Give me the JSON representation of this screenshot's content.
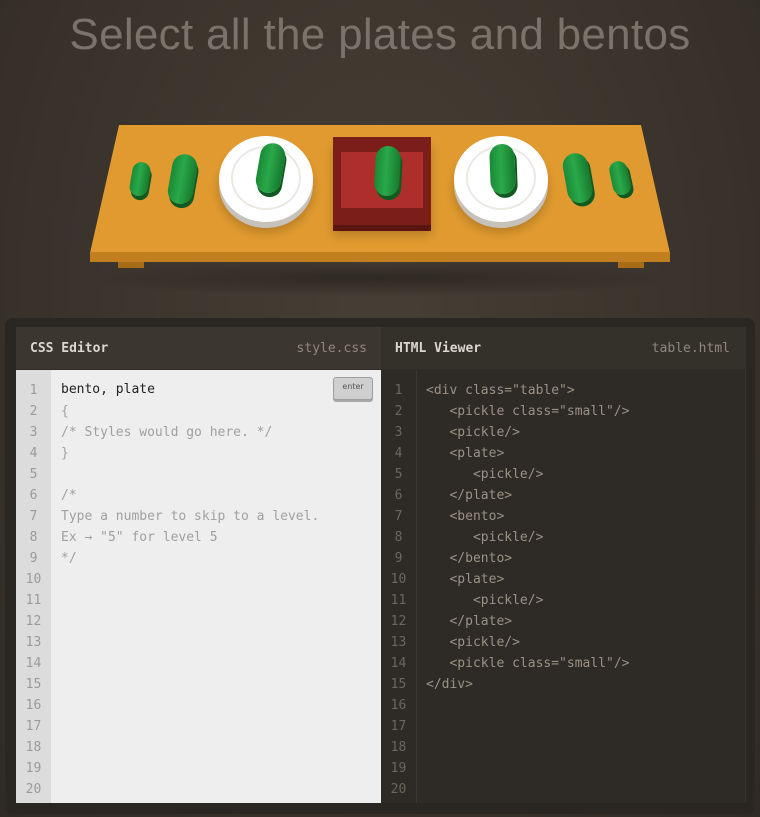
{
  "title": "Select all the plates and bentos",
  "css_editor": {
    "title": "CSS Editor",
    "filename": "style.css",
    "input_value": "bento, plate",
    "enter_label": "enter",
    "lines": [
      "",
      "{",
      "/* Styles would go here. */",
      "}",
      "",
      "/*",
      "Type a number to skip to a level.",
      "Ex → \"5\" for level 5",
      "*/",
      "",
      "",
      "",
      "",
      "",
      "",
      "",
      "",
      "",
      "",
      ""
    ]
  },
  "html_viewer": {
    "title": "HTML Viewer",
    "filename": "table.html",
    "lines": [
      "<div class=\"table\">",
      "   <pickle class=\"small\"/>",
      "   <pickle/>",
      "   <plate>",
      "      <pickle/>",
      "   </plate>",
      "   <bento>",
      "      <pickle/>",
      "   </bento>",
      "   <plate>",
      "      <pickle/>",
      "   </plate>",
      "   <pickle/>",
      "   <pickle class=\"small\"/>",
      "</div>",
      "",
      "",
      "",
      "",
      ""
    ]
  },
  "scene": {
    "items": [
      "pickle-small",
      "pickle",
      "plate-with-pickle",
      "bento-with-pickle",
      "plate-with-pickle",
      "pickle",
      "pickle-small"
    ]
  },
  "colors": {
    "table": "#e09a2f",
    "pickle": "#1a8a35",
    "bento": "#ad2e2b",
    "plate": "#ffffff"
  }
}
